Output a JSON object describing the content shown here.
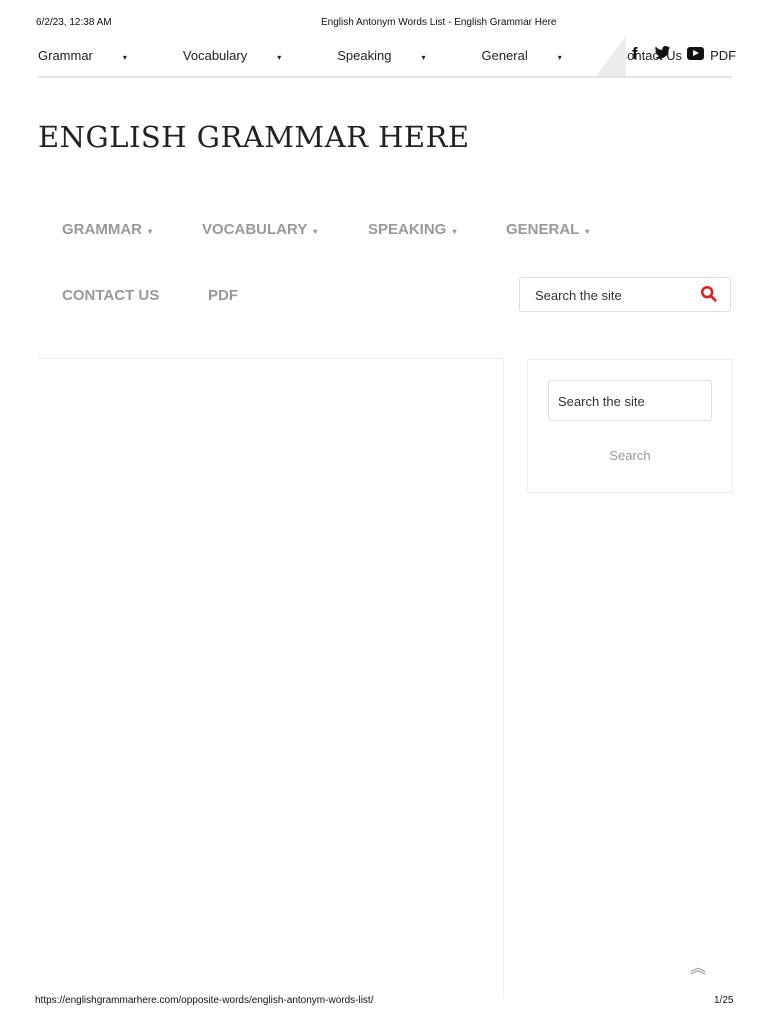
{
  "print_header": {
    "datetime": "6/2/23, 12:38 AM",
    "title": "English Antonym Words List - English Grammar Here"
  },
  "top_nav": [
    {
      "label": "Grammar",
      "dropdown": true
    },
    {
      "label": "Vocabulary",
      "dropdown": true
    },
    {
      "label": "Speaking",
      "dropdown": true
    },
    {
      "label": "General",
      "dropdown": true
    },
    {
      "label": "Contact Us",
      "dropdown": false
    },
    {
      "label": "PDF",
      "dropdown": false
    }
  ],
  "social": {
    "facebook": "f",
    "icons": [
      "facebook-icon",
      "twitter-icon",
      "youtube-icon"
    ]
  },
  "site_title": "ENGLISH GRAMMAR HERE",
  "main_nav": [
    "GRAMMAR",
    "VOCABULARY",
    "SPEAKING",
    "GENERAL",
    "CONTACT US",
    "PDF"
  ],
  "header_search": {
    "placeholder": "Search the site",
    "icon_color": "#e02020"
  },
  "widget_search": {
    "placeholder": "Search the site",
    "button": "Search"
  },
  "caret": "▾",
  "back_to_top": "︽",
  "print_footer": {
    "url": "https://englishgrammarhere.com/opposite-words/english-antonym-words-list/",
    "page": "1/25"
  }
}
